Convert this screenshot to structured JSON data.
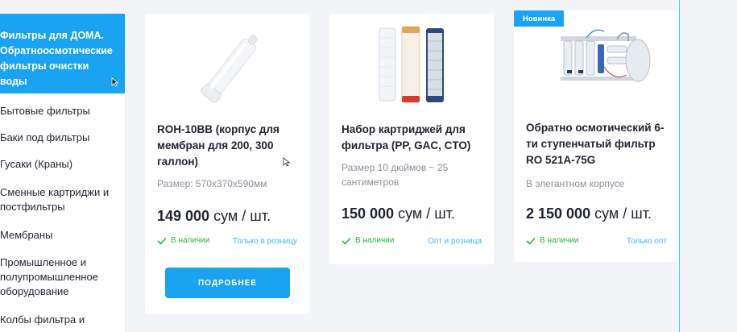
{
  "sidebar": {
    "header": "Фильтры для ДОМА. Обратноосмотические фильтры очистки воды",
    "items": [
      "Бытовые фильтры",
      "Баки под фильтры",
      "Гусаки (Краны)",
      "Сменные картриджи и постфильтры",
      "Мембраны",
      "Промышленное и полупромышленное оборудование",
      "Колбы фильтра и"
    ]
  },
  "products": [
    {
      "title": "ROH-10BB (корпус для мембран для 200, 300 галлон)",
      "subtitle": "Размер: 570x370x590мм",
      "price": "149 000",
      "unit": " сум / шт.",
      "stock": "В наличии",
      "sale": "Только в розницу",
      "button": "ПОДРОБНЕЕ"
    },
    {
      "title": "Набор картриджей для фильтра (PP, GAC, CTO)",
      "subtitle": "Размер 10 дюймов ~ 25 сантиметров",
      "price": "150 000",
      "unit": " сум / шт.",
      "stock": "В наличии",
      "sale": "Опт и розница"
    },
    {
      "badge": "Новинка",
      "title": "Обратно осмотический 6-ти ступенчатый фильтр RO 521A-75G",
      "subtitle": "В элегантном корпусе",
      "price": "2 150 000",
      "unit": " сум / шт.",
      "stock": "В наличии",
      "sale": "Только опт"
    }
  ],
  "colors": {
    "accent": "#1aa3f0",
    "stock": "#2db34a",
    "background": "#f3f4f8"
  },
  "icons": [
    "cursor-icon",
    "check-icon",
    "filter-housing-image",
    "cartridges-image",
    "ro-system-image"
  ]
}
